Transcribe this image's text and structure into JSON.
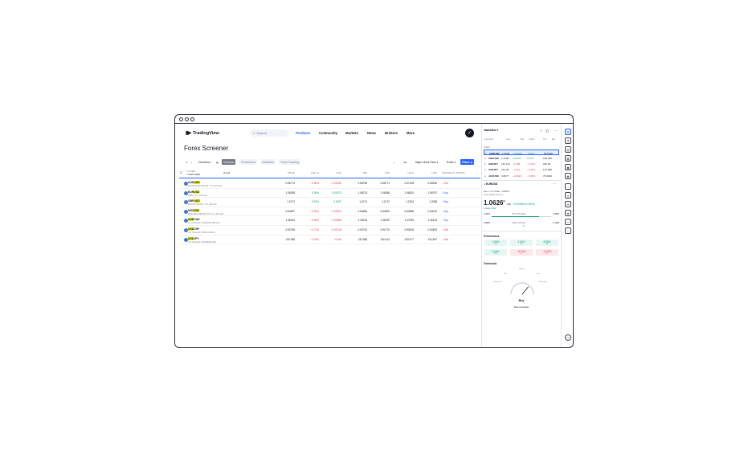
{
  "nav": {
    "logo": "TradingView",
    "search_placeholder": "Search",
    "items": [
      "Products",
      "Community",
      "Markets",
      "News",
      "Brokers",
      "More"
    ],
    "active": "Products"
  },
  "page_title": "Forex Screener",
  "toolbar": {
    "overview_label": "Overview",
    "tabs": [
      "Overview",
      "Performance",
      "Oscillators",
      "Trend-Following"
    ],
    "active_tab": "Overview",
    "majors_label": "Major, Minor Pairs",
    "exotic_label": "Exotic",
    "filters_label": "Filters"
  },
  "table": {
    "count_label": "7 MATCHES",
    "ticker_label": "TICKER",
    "search_value": "usd",
    "columns": [
      "PRICE",
      "CHG %",
      "CHG",
      "BID",
      "ASK",
      "HIGH",
      "LOW",
      "TECHNICAL RATING"
    ],
    "rows": [
      {
        "base": "AUD",
        "quote": "USD",
        "hl": "second",
        "desc": "AUSTRALIAN DOLLAR / U.S. DOLLAR",
        "price": "0.66774",
        "chg_pct": "−0.58%",
        "chg": "−0.00239",
        "bid": "0.66758",
        "ask": "0.66771",
        "high": "0.67438",
        "low": "0.66526",
        "rating": "Sell",
        "dir": "neg"
      },
      {
        "base": "EUR",
        "quote": "USD",
        "hl": "second",
        "desc": "EURO / U.S. DOLLAR",
        "price": "1.06285",
        "chg_pct": "0.35%",
        "chg": "0.00373",
        "bid": "1.06276",
        "ask": "1.06286",
        "high": "1.06520",
        "low": "1.05797",
        "rating": "Buy",
        "dir": "pos"
      },
      {
        "base": "GBP",
        "quote": "USD",
        "hl": "second",
        "desc": "BRITISH POUND / U.S. DOLLAR",
        "price": "1.2172",
        "chg_pct": "0.23%",
        "chg": "0.0027",
        "bid": "1.2171",
        "ask": "1.2172",
        "high": "1.2224",
        "low": "1.2088",
        "rating": "Buy",
        "dir": "pos"
      },
      {
        "base": "NZD",
        "quote": "USD",
        "hl": "second",
        "desc": "NEW ZEALAND DOLLAR / U.S. DOLLAR",
        "price": "0.64487",
        "chg_pct": "−0.29%",
        "chg": "−0.00191",
        "bid": "0.64486",
        "ask": "0.64500",
        "high": "0.64958",
        "low": "0.64012",
        "rating": "Buy",
        "dir": "neg"
      },
      {
        "base": "USD",
        "quote": "CAD",
        "hl": "first",
        "desc": "U.S. DOLLAR / CANADIAN DOLLAR",
        "price": "1.36140",
        "chg_pct": "−0.28%",
        "chg": "−0.00383",
        "bid": "1.36194",
        "ask": "1.36199",
        "high": "1.37045",
        "low": "1.36103",
        "rating": "Buy",
        "dir": "neg"
      },
      {
        "base": "USD",
        "quote": "CHF",
        "hl": "first",
        "desc": "U.S. DOLLAR / SWISS FRANC",
        "price": "0.92759",
        "chg_pct": "−0.77%",
        "chg": "−0.00718",
        "bid": "0.92732",
        "ask": "0.92770",
        "high": "0.93678",
        "low": "0.92493",
        "rating": "Sell",
        "dir": "neg"
      },
      {
        "base": "USD",
        "quote": "JPY",
        "hl": "first",
        "desc": "U.S. DOLLAR / JAPANESE YEN",
        "price": "132.385",
        "chg_pct": "−0.33%",
        "chg": "−0.440",
        "bid": "132.385",
        "ask": "132.413",
        "high": "133.477",
        "low": "131.697",
        "rating": "Sell",
        "dir": "neg"
      }
    ]
  },
  "watchlist": {
    "title": "watchlist",
    "col_symbol": "Symbol",
    "col_last": "Last",
    "col_chg": "Chg",
    "col_chgp": "Chg%",
    "col_vol": "Vol",
    "col_ext": "Ext",
    "section": "FOREX",
    "rows": [
      {
        "sym": "EURUSD",
        "last": "1.0626",
        "chg": "0.00369",
        "chgp": "0.35%",
        "vol": "60.542K",
        "dir": "pos",
        "selected": true
      },
      {
        "sym": "GBPUSD",
        "last": "1.2166",
        "chg": "0.00374",
        "chgp": "0.31%",
        "vol": "108.46K",
        "dir": "pos",
        "selected": false
      },
      {
        "sym": "GBPJPY",
        "last": "161.121",
        "chg": "−0.186",
        "chgp": "−0.12%",
        "vol": "245.3K",
        "dir": "neg",
        "selected": false
      },
      {
        "sym": "USDJPY",
        "last": "132.40",
        "chg": "−0.411",
        "chgp": "−0.31%",
        "vol": "170.28K",
        "dir": "neg",
        "selected": false
      },
      {
        "sym": "AUDUSD",
        "last": "0.6677",
        "chg": "−0.0023",
        "chgp": "−0.35%",
        "vol": "75.049K",
        "dir": "neg",
        "selected": false
      }
    ]
  },
  "details": {
    "symbol": "EURUSD",
    "name": "Euro / U.S. Dollar",
    "exchange": "OANDA",
    "type": "Forex Market Currency",
    "price": "1.0626",
    "price_small": "0",
    "currency": "USD",
    "change": "+0.00369 (0.35%)",
    "status": "Market Open",
    "range_low": "1.0579",
    "range_high": "1.0652",
    "range_label": "DAY'S RANGE",
    "range52_low": "0.9535",
    "range52_high": "1.1495",
    "range52_label": "52WK RANGE",
    "performance_title": "Performance",
    "perf": [
      {
        "value": "2.95%",
        "label": "1W",
        "dir": "pos"
      },
      {
        "value": "2.54%",
        "label": "1M",
        "dir": "pos"
      },
      {
        "value": "8.85%",
        "label": "3M",
        "dir": "pos"
      },
      {
        "value": "0.60%",
        "label": "YTD",
        "dir": "pos"
      },
      {
        "value": "−8.54%",
        "label": "1Y",
        "dir": "neg"
      },
      {
        "value": "−8.40%",
        "label": "5Y",
        "dir": "neg"
      }
    ],
    "technicals_title": "Technicals",
    "gauge_labels": [
      "Strong sell",
      "Sell",
      "Neutral",
      "Buy",
      "Strong buy"
    ],
    "gauge_result": "Buy",
    "more_technicals": "More technicals",
    "gauge_value": 0.72
  }
}
